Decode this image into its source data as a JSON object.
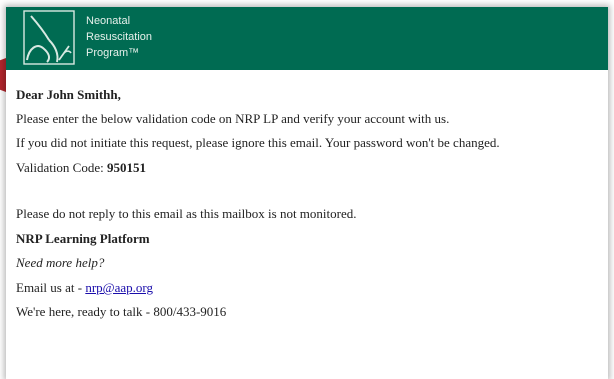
{
  "brand": {
    "line1": "Neonatal",
    "line2": "Resuscitation",
    "line3": "Program™"
  },
  "email": {
    "greeting": "Dear John Smithh,",
    "instruction": "Please enter the below validation code on NRP LP and verify your account with us.",
    "ignore_notice": "If you did not initiate this request, please ignore this email. Your password won't be changed.",
    "code_label": "Validation Code:",
    "code_value": "950151",
    "no_reply": "Please do not reply to this email as this mailbox is not monitored.",
    "signature": "NRP Learning Platform",
    "help_prompt": "Need more help?",
    "email_label": "Email us at -",
    "email_address": "nrp@aap.org",
    "phone_line": "We're here, ready to talk - 800/433-9016"
  },
  "colors": {
    "header_green": "#006b52",
    "arrow_red": "#b3262d",
    "link_blue": "#1a0dab"
  },
  "icons": {
    "logo": "nrp-logo-icon",
    "arrow": "red-arrow-pointer"
  }
}
